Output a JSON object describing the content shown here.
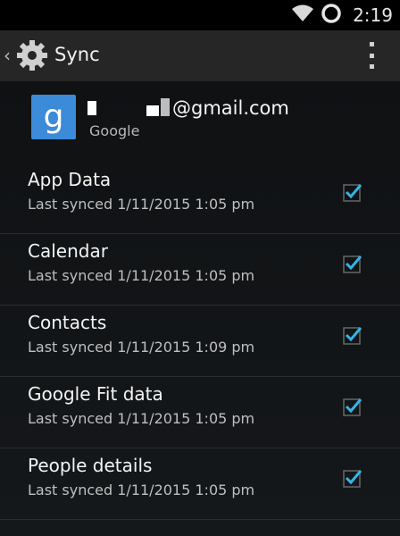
{
  "status_bar": {
    "time": "2:19",
    "icons": [
      "wifi-icon",
      "sync-circle-icon"
    ]
  },
  "action_bar": {
    "title": "Sync",
    "icons": [
      "back-chevron-icon",
      "settings-gear-icon",
      "overflow-menu-icon"
    ]
  },
  "account": {
    "email": "@gmail.com",
    "provider": "Google",
    "logo_letter": "g"
  },
  "sync_items": [
    {
      "label": "App Data",
      "status": "Last synced 1/11/2015 1:05 pm",
      "checked": true
    },
    {
      "label": "Calendar",
      "status": "Last synced 1/11/2015 1:05 pm",
      "checked": true
    },
    {
      "label": "Contacts",
      "status": "Last synced 1/11/2015 1:09 pm",
      "checked": true
    },
    {
      "label": "Google Fit data",
      "status": "Last synced 1/11/2015 1:05 pm",
      "checked": true
    },
    {
      "label": "People details",
      "status": "Last synced 1/11/2015 1:05 pm",
      "checked": true
    }
  ],
  "colors": {
    "action_bar": "#262626",
    "checkmark": "#33b5e5",
    "google_logo": "#3b8bd9"
  }
}
